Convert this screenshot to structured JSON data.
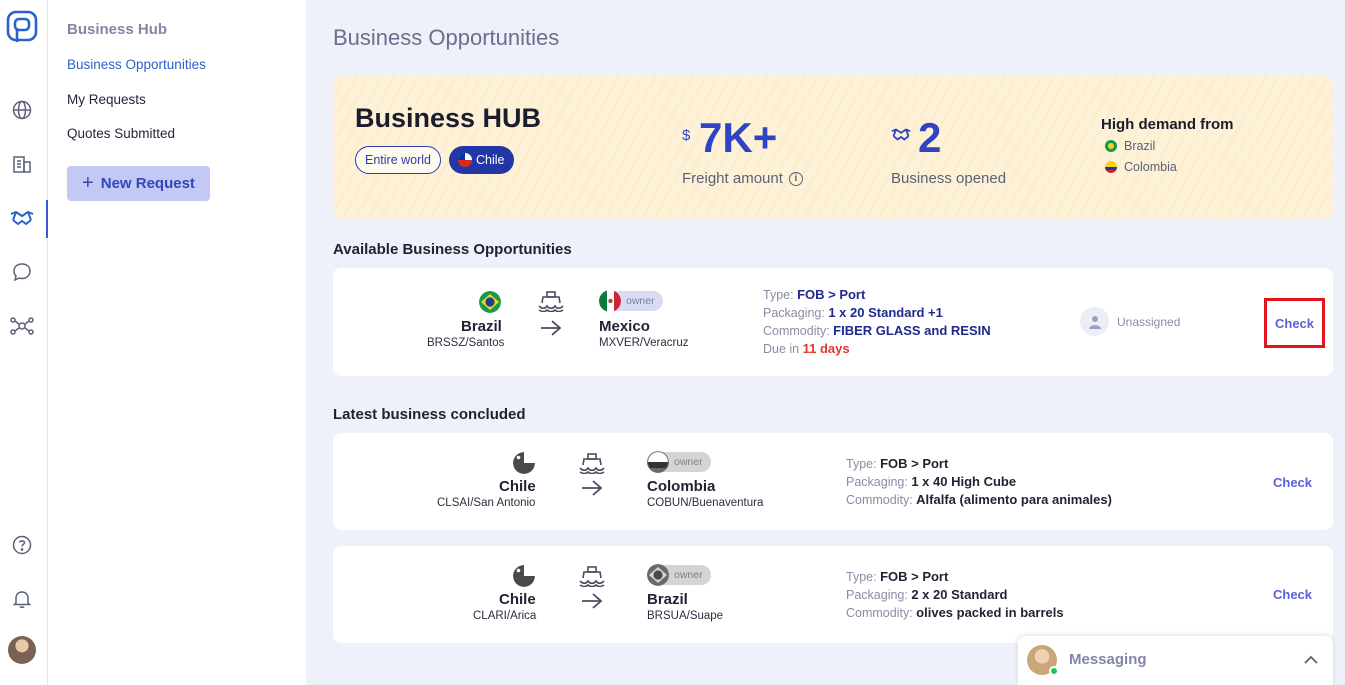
{
  "nav": {
    "section_title": "Business Hub",
    "items": [
      {
        "label": "Business Opportunities",
        "active": true
      },
      {
        "label": "My Requests",
        "active": false
      },
      {
        "label": "Quotes Submitted",
        "active": false
      }
    ],
    "new_request_label": "New Request"
  },
  "rail": {
    "icons": [
      "logo-icon",
      "globe-icon",
      "building-icon",
      "handshake-icon",
      "chat-icon",
      "network-icon",
      "help-icon",
      "bell-icon",
      "user-avatar"
    ]
  },
  "page_title": "Business Opportunities",
  "hero": {
    "title": "Business HUB",
    "filter_all": "Entire world",
    "filter_selected": "Chile",
    "freight_currency": "$",
    "freight_value": "7K+",
    "freight_label": "Freight amount",
    "business_value": "2",
    "business_label": "Business opened",
    "demand_title": "High demand from",
    "demand": [
      "Brazil",
      "Colombia"
    ]
  },
  "available": {
    "title": "Available Business Opportunities",
    "items": [
      {
        "origin": "Brazil",
        "origin_code": "BRSSZ/Santos",
        "destination": "Mexico",
        "destination_code": "MXVER/Veracruz",
        "owner_label": "owner",
        "type_label": "Type:",
        "type": "FOB > Port",
        "packaging_label": "Packaging:",
        "packaging": "1 x 20 Standard +1",
        "commodity_label": "Commodity:",
        "commodity": "FIBER GLASS and RESIN",
        "due_label": "Due in",
        "due": "11 days",
        "assignee": "Unassigned",
        "action": "Check"
      }
    ]
  },
  "concluded": {
    "title": "Latest business concluded",
    "items": [
      {
        "origin": "Chile",
        "origin_code": "CLSAI/San Antonio",
        "destination": "Colombia",
        "destination_code": "COBUN/Buenaventura",
        "owner_label": "owner",
        "type_label": "Type:",
        "type": "FOB > Port",
        "packaging_label": "Packaging:",
        "packaging": "1 x 40 High Cube",
        "commodity_label": "Commodity:",
        "commodity": "Alfalfa (alimento para animales)",
        "action": "Check"
      },
      {
        "origin": "Chile",
        "origin_code": "CLARI/Arica",
        "destination": "Brazil",
        "destination_code": "BRSUA/Suape",
        "owner_label": "owner",
        "type_label": "Type:",
        "type": "FOB > Port",
        "packaging_label": "Packaging:",
        "packaging": "2 x 20 Standard",
        "commodity_label": "Commodity:",
        "commodity": "olives packed in barrels",
        "action": "Check"
      }
    ]
  },
  "messaging": {
    "title": "Messaging"
  },
  "colors": {
    "accent": "#3043c4",
    "highlight_box": "#e3141b",
    "hero_bg": "#fdf2d7",
    "due_red": "#e2372f"
  }
}
